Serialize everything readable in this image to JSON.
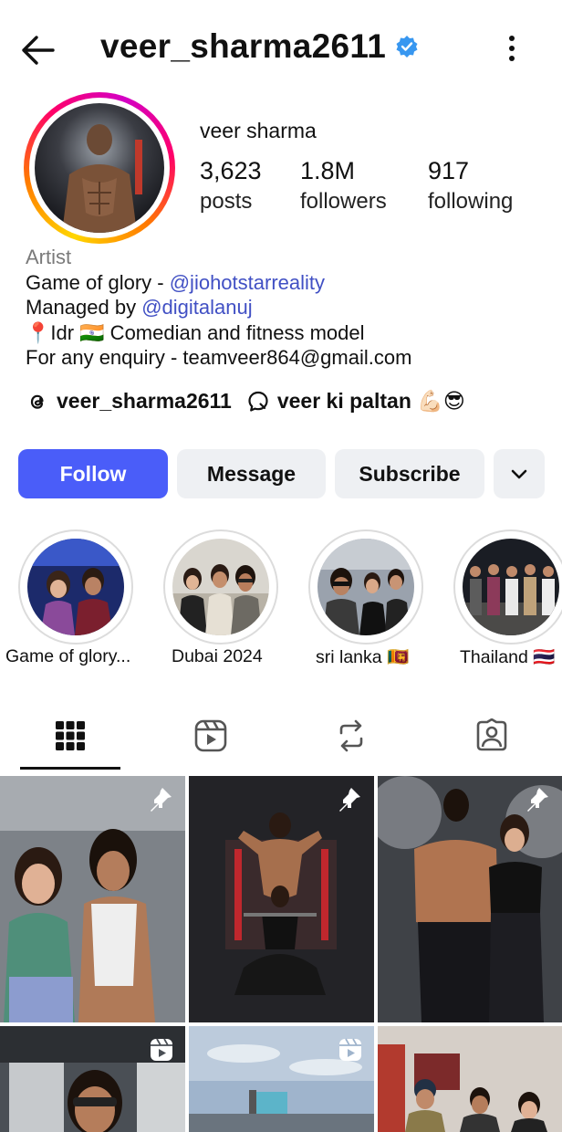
{
  "header": {
    "username": "veer_sharma2611",
    "verified": true
  },
  "profile": {
    "display_name": "veer sharma",
    "stats": [
      {
        "value": "3,623",
        "label": "posts"
      },
      {
        "value": "1.8M",
        "label": "followers"
      },
      {
        "value": "917",
        "label": "following"
      }
    ]
  },
  "bio": {
    "category": "Artist",
    "line1_prefix": "Game of glory - ",
    "line1_link": "@jiohotstarreality",
    "line2_prefix": "Managed by ",
    "line2_link": "@digitalanuj",
    "line3": "📍Idr 🇮🇳 Comedian and fitness model",
    "line4": "For any enquiry - teamveer864@gmail.com"
  },
  "links": {
    "threads_handle": "veer_sharma2611",
    "channel_name": "veer ki paltan 💪🏻😎"
  },
  "actions": {
    "follow_label": "Follow",
    "message_label": "Message",
    "subscribe_label": "Subscribe",
    "more_icon": "chevron-down-icon"
  },
  "highlights": [
    {
      "label": "Game of glory..."
    },
    {
      "label": "Dubai 2024"
    },
    {
      "label": "sri lanka 🇱🇰"
    },
    {
      "label": "Thailand 🇹🇭"
    }
  ],
  "tabs": [
    {
      "icon": "grid-icon",
      "active": true
    },
    {
      "icon": "reels-icon",
      "active": false
    },
    {
      "icon": "reposts-icon",
      "active": false
    },
    {
      "icon": "tagged-icon",
      "active": false
    }
  ],
  "posts": [
    {
      "badge": "pin-icon"
    },
    {
      "badge": "pin-icon"
    },
    {
      "badge": "pin-icon"
    },
    {
      "badge": "reel-icon"
    },
    {
      "badge": "reel-icon"
    },
    {
      "badge": ""
    }
  ],
  "colors": {
    "follow_button": "#4a5df9",
    "secondary_button": "#eef0f3",
    "link": "#4150c4",
    "verified": "#3897f0"
  }
}
